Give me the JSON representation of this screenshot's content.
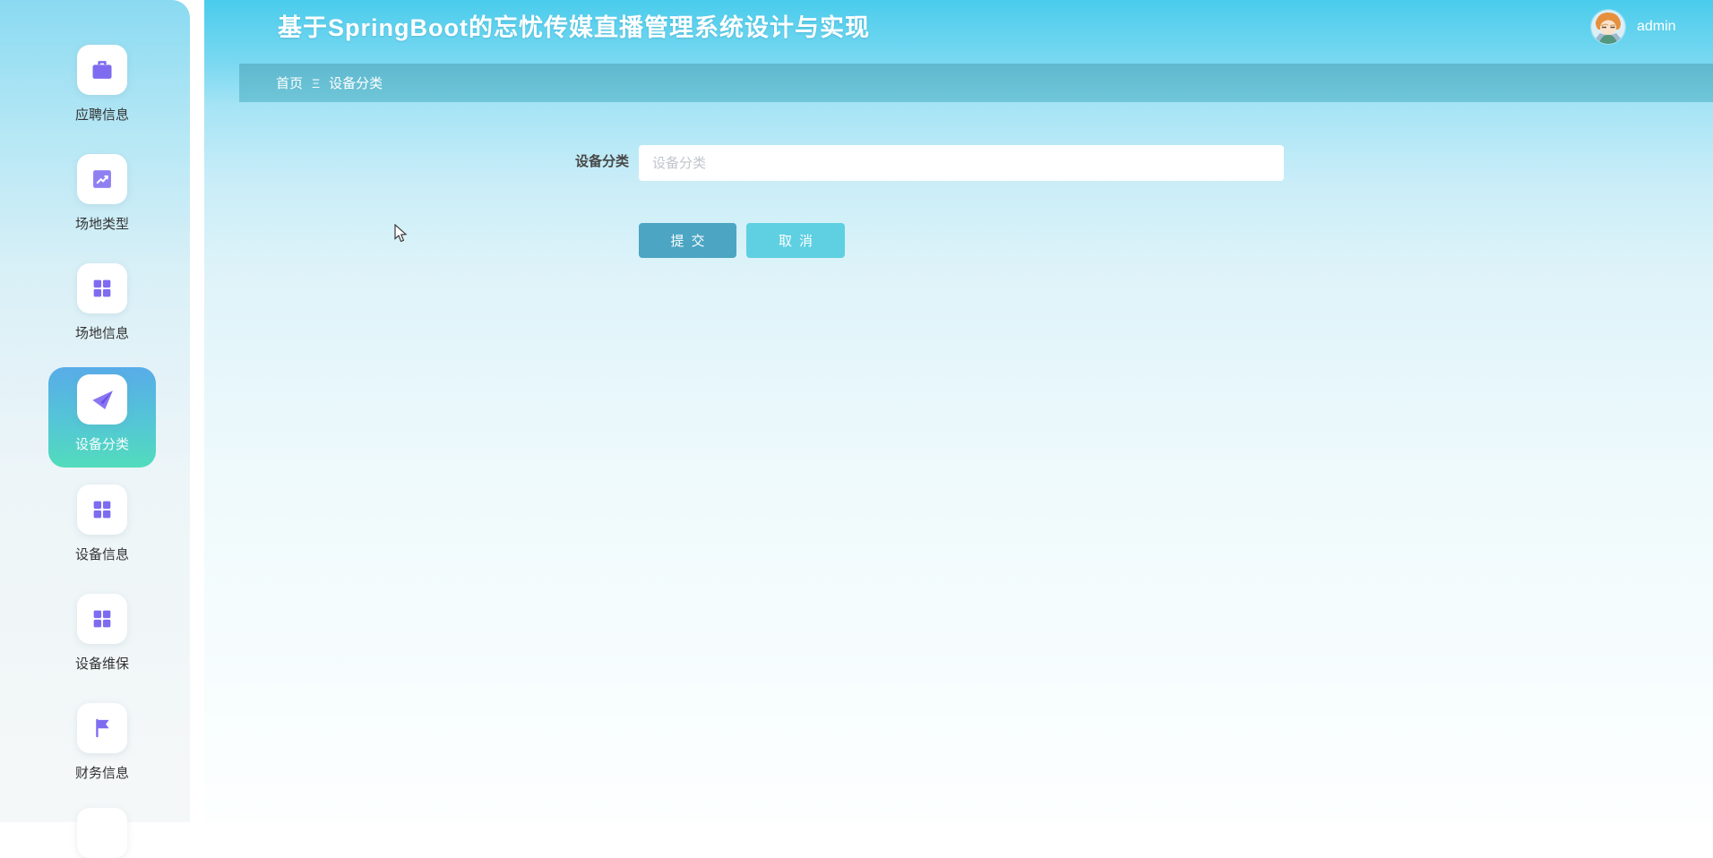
{
  "header": {
    "title": "基于SpringBoot的忘忧传媒直播管理系统设计与实现",
    "user": {
      "name": "admin"
    }
  },
  "breadcrumb": {
    "home": "首页",
    "separator_glyph": "Ξ",
    "current": "设备分类"
  },
  "sidebar": {
    "items": [
      {
        "label": "应聘信息",
        "icon": "briefcase-icon",
        "active": false
      },
      {
        "label": "场地类型",
        "icon": "trend-chart-icon",
        "active": false
      },
      {
        "label": "场地信息",
        "icon": "grid-icon",
        "active": false
      },
      {
        "label": "设备分类",
        "icon": "paper-plane-icon",
        "active": true
      },
      {
        "label": "设备信息",
        "icon": "grid-icon",
        "active": false
      },
      {
        "label": "设备维保",
        "icon": "grid-icon",
        "active": false
      },
      {
        "label": "财务信息",
        "icon": "flag-icon",
        "active": false
      }
    ]
  },
  "form": {
    "field_label": "设备分类",
    "input": {
      "value": "",
      "placeholder": "设备分类"
    },
    "submit_label": "提交",
    "cancel_label": "取消"
  },
  "colors": {
    "accent_purple": "#7d6cf0",
    "active_gradient_start": "#58ace8",
    "active_gradient_end": "#52dcbc",
    "submit_bg": "#4ba5c3",
    "cancel_bg": "#5ed0e2",
    "breadcrumb_bar": "#66bfd4",
    "header_top": "#4accec"
  }
}
